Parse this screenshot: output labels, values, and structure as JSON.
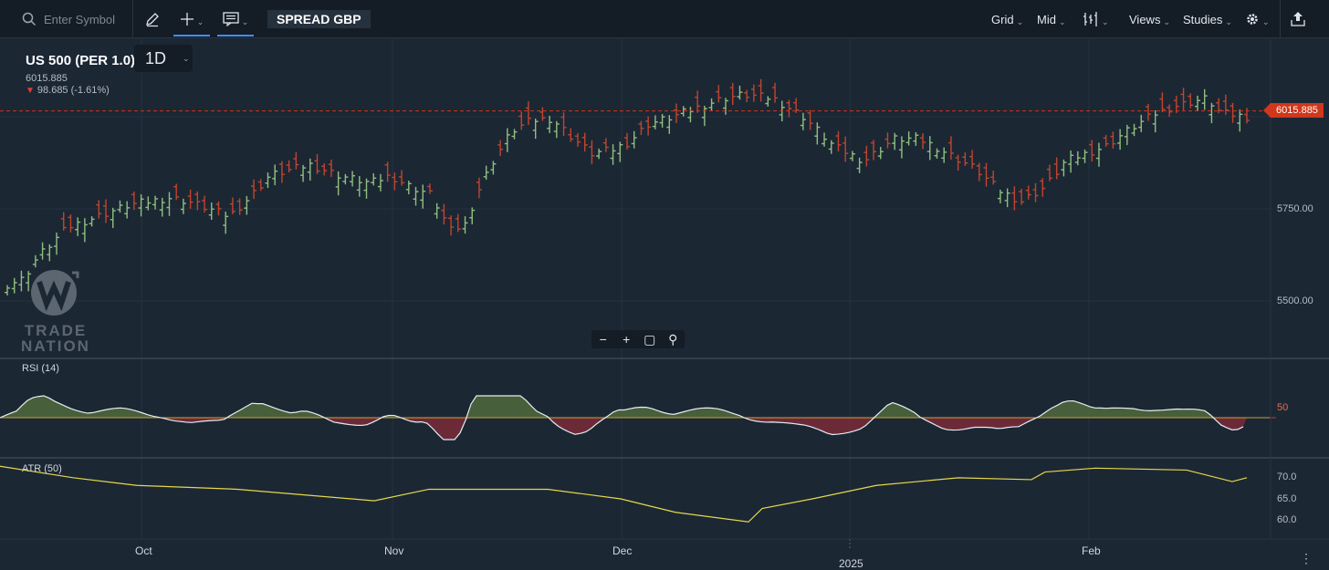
{
  "toolbar": {
    "search_placeholder": "Enter Symbol",
    "spread_label": "SPREAD GBP",
    "menu": [
      "Grid",
      "Mid",
      "Views",
      "Studies"
    ]
  },
  "symbol": {
    "name": "US 500 (PER 1.0)",
    "timeframe": "1D",
    "last": "6015.885",
    "change": "98.685 (-1.61%)",
    "price_tag": "6015.885"
  },
  "axes": {
    "price_labels": [
      "5750.00",
      "5500.00"
    ],
    "rsi_label": "RSI (14)",
    "rsi_level": "50",
    "atr_label": "ATR (50)",
    "atr_labels": [
      "70.0",
      "65.0",
      "60.0"
    ],
    "x_labels": [
      "Oct",
      "Nov",
      "Dec",
      "2025",
      "Feb"
    ]
  },
  "logo": {
    "line1": "TRADE",
    "line2": "NATION"
  },
  "colors": {
    "up": "#8fbf7f",
    "down": "#c0452e",
    "accent": "#3f8ff7",
    "price_tag": "#d0371b",
    "atr": "#e5d84a"
  },
  "chart_data": {
    "type": "ohlc",
    "timeframe": "1D",
    "last_price": 6015.885,
    "up_pattern": "ggggggggrrgggrrgggrgggggrgrrrgrgrrgrrggrrrggrrrgggggggrrrgggrgrrrggrggrggrrgrggrrrrrgrggrgrrgggrggrggrgrgrrrgrgrrgrgggrrggrrgrggggrgggrrrrrrrggrrrrrrrggggrgrrggggrgrrrrrgggrrrgr",
    "close_path": [
      [
        0,
        5545
      ],
      [
        8,
        5560
      ],
      [
        15,
        5620
      ],
      [
        30,
        5700
      ],
      [
        60,
        5760
      ],
      [
        80,
        5780
      ],
      [
        90,
        5770
      ],
      [
        110,
        5730
      ],
      [
        120,
        5780
      ],
      [
        130,
        5840
      ],
      [
        150,
        5870
      ],
      [
        165,
        5840
      ],
      [
        180,
        5820
      ],
      [
        190,
        5840
      ],
      [
        200,
        5810
      ],
      [
        210,
        5790
      ],
      [
        215,
        5740
      ],
      [
        220,
        5690
      ],
      [
        228,
        5710
      ],
      [
        232,
        5780
      ],
      [
        240,
        5870
      ],
      [
        250,
        5960
      ],
      [
        260,
        5990
      ],
      [
        270,
        5995
      ],
      [
        280,
        5945
      ],
      [
        290,
        5900
      ],
      [
        300,
        5910
      ],
      [
        308,
        5930
      ],
      [
        318,
        5980
      ],
      [
        330,
        6000
      ],
      [
        340,
        6020
      ],
      [
        355,
        6050
      ],
      [
        365,
        6060
      ],
      [
        380,
        6050
      ],
      [
        395,
        6000
      ],
      [
        410,
        5920
      ],
      [
        425,
        5880
      ],
      [
        440,
        5940
      ],
      [
        452,
        5940
      ],
      [
        460,
        5920
      ],
      [
        470,
        5890
      ],
      [
        480,
        5860
      ],
      [
        492,
        5800
      ],
      [
        503,
        5770
      ],
      [
        515,
        5810
      ],
      [
        525,
        5880
      ],
      [
        545,
        5920
      ],
      [
        555,
        5960
      ],
      [
        570,
        6010
      ],
      [
        580,
        6030
      ],
      [
        595,
        6050
      ],
      [
        602,
        6010
      ],
      [
        615,
        6000
      ]
    ],
    "rsi_y_range": [
      30,
      80
    ],
    "atr_y_range": [
      55,
      74
    ]
  }
}
